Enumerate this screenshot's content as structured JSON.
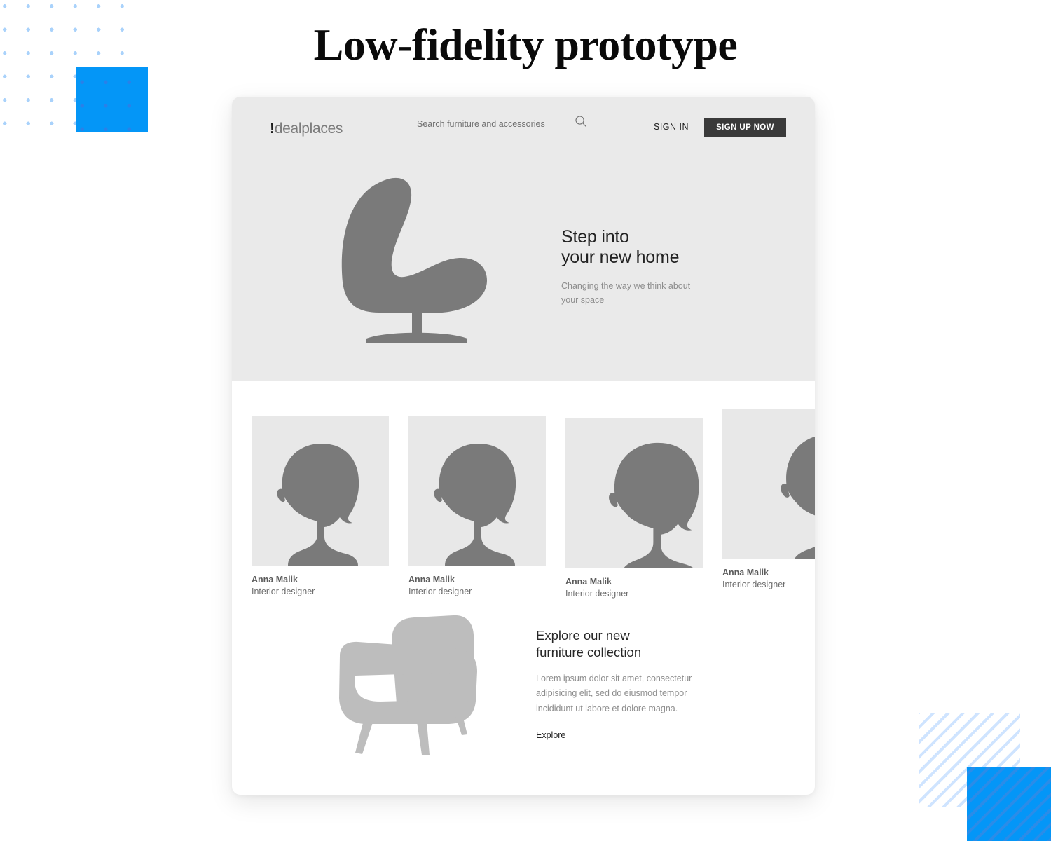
{
  "page": {
    "title": "Low-fidelity prototype"
  },
  "decorations": {
    "dot_grid": "dot-grid-pattern",
    "diagonal_stripes": "diagonal-stripes-pattern",
    "accent_color": "#0496f7",
    "dot_color": "#a9d2fb",
    "stripe_color": "#cfe4ff"
  },
  "site": {
    "header": {
      "logo_bang": "!",
      "logo_text": "dealplaces",
      "search": {
        "placeholder": "Search furniture and accessories",
        "value": "",
        "icon": "search-icon"
      },
      "sign_in_label": "SIGN IN",
      "sign_up_label": "SIGN UP NOW",
      "sign_up_bg": "#3a3a3a"
    },
    "hero": {
      "background": "#eaeaea",
      "illustration": "egg-chair-silhouette",
      "heading_line1": "Step into",
      "heading_line2": "your new home",
      "subtext_line1": "Changing the way we think about",
      "subtext_line2": "your space"
    },
    "designers": [
      {
        "name": "Anna Malik",
        "role": "Interior designer",
        "image": "woman-profile-silhouette"
      },
      {
        "name": "Anna Malik",
        "role": "Interior designer",
        "image": "woman-profile-silhouette"
      },
      {
        "name": "Anna Malik",
        "role": "Interior designer",
        "image": "woman-profile-silhouette"
      },
      {
        "name": "Anna Malik",
        "role": "Interior designer",
        "image": "woman-profile-silhouette"
      }
    ],
    "explore": {
      "illustration": "armchair-silhouette",
      "heading_line1": "Explore our new",
      "heading_line2": "furniture collection",
      "body": "Lorem ipsum dolor sit amet, consectetur adipisicing elit, sed do eiusmod tempor incididunt ut labore et dolore magna.",
      "link_label": "Explore"
    }
  }
}
